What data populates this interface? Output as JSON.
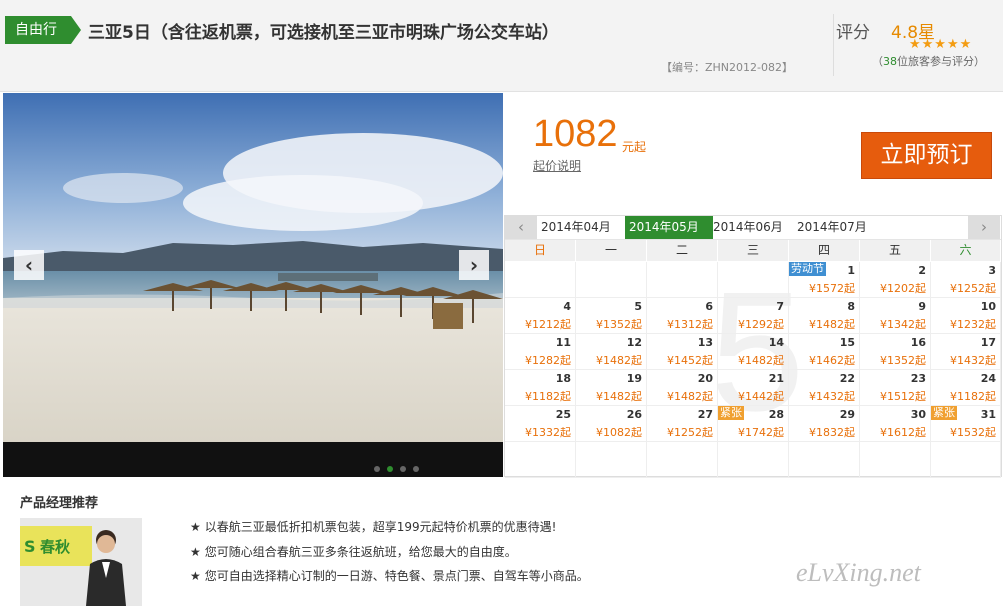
{
  "header": {
    "tag": "自由行",
    "title": "三亚5日（含往返机票，可选接机至三亚市明珠广场公交车站）",
    "code": "【编号：ZHN2012-082】",
    "rating_label": "评分",
    "rating_value": "4.8星",
    "stars": "★★★★★",
    "rating_count_prefix": "（",
    "rating_count": "38",
    "rating_count_suffix": "位旅客参与评分）"
  },
  "gallery": {
    "prev_icon": "‹",
    "next_icon": "›",
    "slides": 4,
    "active_slide": 2
  },
  "booking": {
    "price": "1082",
    "price_unit": "元起",
    "price_note": "起价说明",
    "book_button": "立即预订"
  },
  "calendar": {
    "prev_icon": "‹",
    "next_icon": "›",
    "months": [
      "2014年04月",
      "2014年05月",
      "2014年06月",
      "2014年07月"
    ],
    "active_month": 1,
    "watermark": "5",
    "weekdays": [
      "日",
      "一",
      "二",
      "三",
      "四",
      "五",
      "六"
    ],
    "days": [
      {
        "row": 0,
        "col": 4,
        "day": "1",
        "price": "¥1572起",
        "badge": "劳动节",
        "badge_type": "holiday"
      },
      {
        "row": 0,
        "col": 5,
        "day": "2",
        "price": "¥1202起"
      },
      {
        "row": 0,
        "col": 6,
        "day": "3",
        "price": "¥1252起"
      },
      {
        "row": 1,
        "col": 0,
        "day": "4",
        "price": "¥1212起"
      },
      {
        "row": 1,
        "col": 1,
        "day": "5",
        "price": "¥1352起"
      },
      {
        "row": 1,
        "col": 2,
        "day": "6",
        "price": "¥1312起"
      },
      {
        "row": 1,
        "col": 3,
        "day": "7",
        "price": "¥1292起"
      },
      {
        "row": 1,
        "col": 4,
        "day": "8",
        "price": "¥1482起"
      },
      {
        "row": 1,
        "col": 5,
        "day": "9",
        "price": "¥1342起"
      },
      {
        "row": 1,
        "col": 6,
        "day": "10",
        "price": "¥1232起"
      },
      {
        "row": 2,
        "col": 0,
        "day": "11",
        "price": "¥1282起"
      },
      {
        "row": 2,
        "col": 1,
        "day": "12",
        "price": "¥1482起"
      },
      {
        "row": 2,
        "col": 2,
        "day": "13",
        "price": "¥1452起"
      },
      {
        "row": 2,
        "col": 3,
        "day": "14",
        "price": "¥1482起"
      },
      {
        "row": 2,
        "col": 4,
        "day": "15",
        "price": "¥1462起"
      },
      {
        "row": 2,
        "col": 5,
        "day": "16",
        "price": "¥1352起"
      },
      {
        "row": 2,
        "col": 6,
        "day": "17",
        "price": "¥1432起"
      },
      {
        "row": 3,
        "col": 0,
        "day": "18",
        "price": "¥1182起"
      },
      {
        "row": 3,
        "col": 1,
        "day": "19",
        "price": "¥1482起"
      },
      {
        "row": 3,
        "col": 2,
        "day": "20",
        "price": "¥1482起"
      },
      {
        "row": 3,
        "col": 3,
        "day": "21",
        "price": "¥1442起"
      },
      {
        "row": 3,
        "col": 4,
        "day": "22",
        "price": "¥1432起"
      },
      {
        "row": 3,
        "col": 5,
        "day": "23",
        "price": "¥1512起"
      },
      {
        "row": 3,
        "col": 6,
        "day": "24",
        "price": "¥1182起"
      },
      {
        "row": 4,
        "col": 0,
        "day": "25",
        "price": "¥1332起"
      },
      {
        "row": 4,
        "col": 1,
        "day": "26",
        "price": "¥1082起"
      },
      {
        "row": 4,
        "col": 2,
        "day": "27",
        "price": "¥1252起"
      },
      {
        "row": 4,
        "col": 3,
        "day": "28",
        "price": "¥1742起",
        "badge": "紧张",
        "badge_type": "tight"
      },
      {
        "row": 4,
        "col": 4,
        "day": "29",
        "price": "¥1832起"
      },
      {
        "row": 4,
        "col": 5,
        "day": "30",
        "price": "¥1612起"
      },
      {
        "row": 4,
        "col": 6,
        "day": "31",
        "price": "¥1532起",
        "badge": "紧张",
        "badge_type": "tight"
      }
    ]
  },
  "manager": {
    "title": "产品经理推荐",
    "photo_banner_text": "春秋",
    "features": [
      "以春航三亚最低折扣机票包装，超享199元起特价机票的优惠待遇!",
      "您可随心组合春航三亚多条往返航班，给您最大的自由度。",
      "您可自由选择精心订制的一日游、特色餐、景点门票、自驾车等小商品。"
    ],
    "bullet": "★"
  },
  "watermark": "eLvXing.net"
}
